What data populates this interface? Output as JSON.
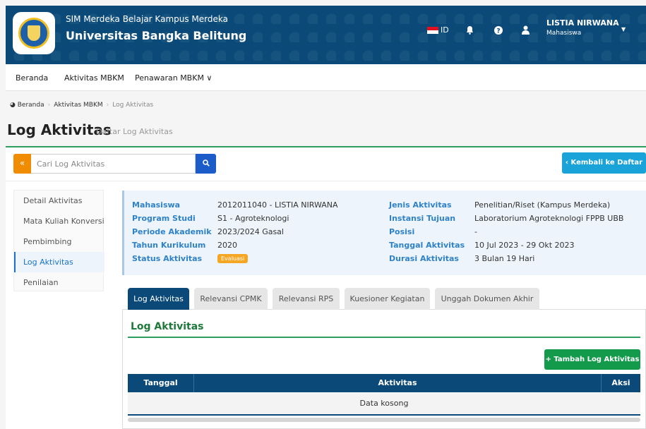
{
  "header": {
    "subtitle": "SIM Merdeka Belajar Kampus Merdeka",
    "title": "Universitas Bangka Belitung",
    "language": "ID",
    "user_name": "LISTIA NIRWANA",
    "user_role": "Mahasiswa"
  },
  "nav": {
    "items": [
      "Beranda",
      "Aktivitas MBKM",
      "Penawaran MBKM ∨"
    ]
  },
  "breadcrumb": [
    "Beranda",
    "Aktivitas MBKM",
    "Log Aktivitas"
  ],
  "page": {
    "title": "Log Aktivitas",
    "subtitle": "Daftar Log Aktivitas"
  },
  "toolbar": {
    "search_placeholder": "Cari Log Aktivitas",
    "back_label": "‹ Kembali ke Daftar"
  },
  "side_menu": [
    "Detail Aktivitas",
    "Mata Kuliah Konversi",
    "Pembimbing",
    "Log Aktivitas",
    "Penilaian"
  ],
  "info": {
    "left": [
      {
        "label": "Mahasiswa",
        "value": "2012011040 - LISTIA NIRWANA"
      },
      {
        "label": "Program Studi",
        "value": "S1 - Agroteknologi"
      },
      {
        "label": "Periode Akademik",
        "value": "2023/2024 Gasal"
      },
      {
        "label": "Tahun Kurikulum",
        "value": "2020"
      },
      {
        "label": "Status Aktivitas",
        "value": "Evaluasi"
      }
    ],
    "right": [
      {
        "label": "Jenis Aktivitas",
        "value": "Penelitian/Riset (Kampus Merdeka)"
      },
      {
        "label": "Instansi Tujuan",
        "value": "Laboratorium Agroteknologi FPPB UBB"
      },
      {
        "label": "Posisi",
        "value": "-"
      },
      {
        "label": "Tanggal Aktivitas",
        "value": "10 Jul 2023 - 29 Okt 2023"
      },
      {
        "label": "Durasi Aktivitas",
        "value": "3 Bulan 19 Hari"
      }
    ]
  },
  "tabs": [
    "Log Aktivitas",
    "Relevansi CPMK",
    "Relevansi RPS",
    "Kuesioner Kegiatan",
    "Unggah Dokumen Akhir"
  ],
  "panel": {
    "title": "Log Aktivitas",
    "add_label": "+ Tambah Log Aktivitas"
  },
  "table": {
    "headers": [
      "Tanggal",
      "Aktivitas",
      "Aksi"
    ],
    "empty_text": "Data kosong"
  },
  "colors": {
    "header_bg": "#0b4a78",
    "accent_green": "#139a4a",
    "accent_blue": "#1aa3d9",
    "accent_orange": "#f08c00",
    "label_blue": "#2f82c8"
  }
}
